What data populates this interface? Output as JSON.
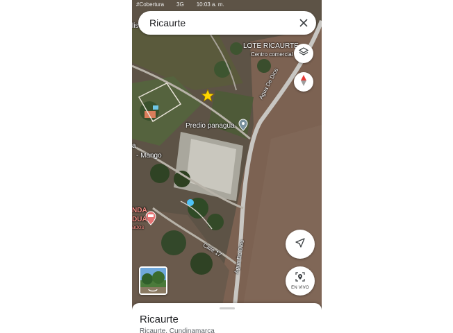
{
  "status_bar": {
    "carrier": "#Cobertura",
    "network": "3G",
    "time": "10:03 a. m."
  },
  "search": {
    "query": "Ricaurte",
    "close_icon": "close-icon"
  },
  "map_labels": {
    "lote": "LOTE RICAURTE",
    "centro": "Centro comercial",
    "predio": "Predio panagua",
    "agua_top": "Agua De Dios",
    "agua_bottom": "Agua De Dios",
    "mango": "- Mango",
    "calle": "Calle 17",
    "nda": "NDA",
    "dua": "DUA",
    "ados": "ados",
    "left_a": "a",
    "left_lis": "lis"
  },
  "controls": {
    "layers_icon": "layers-icon",
    "compass_icon": "compass-icon",
    "navigate_icon": "navigate-arrow-icon",
    "live_label": "EN VIVO"
  },
  "colors": {
    "accent_red": "#e53935",
    "star_yellow": "#ffd600",
    "road_gray": "#bdbdbd"
  },
  "sheet": {
    "title": "Ricaurte",
    "subtitle": "Ricaurte, Cundinamarca"
  }
}
